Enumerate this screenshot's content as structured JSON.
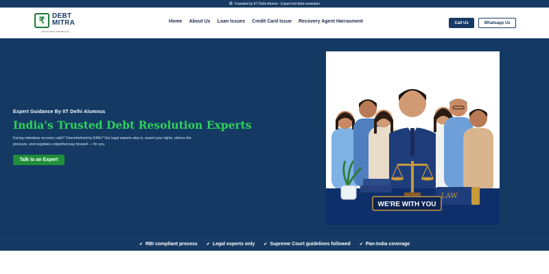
{
  "topbar": {
    "icon": "star-icon",
    "text": "Founded by IIT Delhi Alumni - Expert-led debt resolution"
  },
  "logo": {
    "line1": "DEBT",
    "line2": "MITRA",
    "tagline": "Resolving Debts | Rebuilding Lives"
  },
  "nav": {
    "items": [
      "Home",
      "About Us",
      "Loan Issues",
      "Credit Card Issue",
      "Recovery Agent Harrasment"
    ]
  },
  "header_buttons": {
    "call": "Call Us",
    "whatsapp": "Whatsapp Us"
  },
  "hero": {
    "eyebrow": "Expert Guidance By IIT Delhi Alumnus",
    "headline": "India's Trusted Debt Resolution Experts",
    "description": "Facing relentless recovery calls? Overwhelmed by EMIs? Our legal experts step in, assert your rights, silence the pressure, and negotiate a dignified way forward — for you.",
    "cta": "Talk to an Expert",
    "illustration": {
      "banner": "WE'RE WITH YOU",
      "book_label": "LAW"
    }
  },
  "features": [
    "RBI compliant process",
    "Legal experts only",
    "Supreme Court guidelines followed",
    "Pan-India coverage"
  ],
  "colors": {
    "navy": "#143a64",
    "green": "#2fd05a",
    "button_green": "#1f8f3a"
  }
}
